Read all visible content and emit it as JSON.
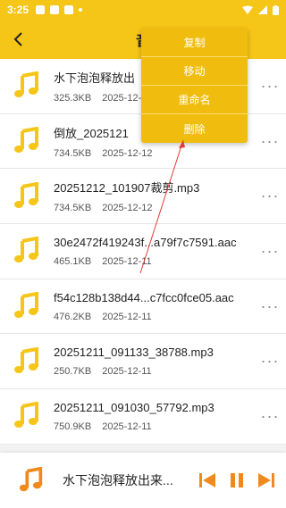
{
  "status": {
    "time": "3:25"
  },
  "header": {
    "title": "音"
  },
  "menu": {
    "items": [
      "复制",
      "移动",
      "重命名",
      "删除"
    ]
  },
  "files": [
    {
      "name": "水下泡泡释放出",
      "size": "325.3KB",
      "date": "2025-12-1"
    },
    {
      "name": "倒放_2025121",
      "size": "734.5KB",
      "date": "2025-12-12"
    },
    {
      "name": "20251212_101907裁剪.mp3",
      "size": "734.5KB",
      "date": "2025-12-12"
    },
    {
      "name": "30e2472f419243f...a79f7c7591.aac",
      "size": "465.1KB",
      "date": "2025-12-11"
    },
    {
      "name": "f54c128b138d44...c7fcc0fce05.aac",
      "size": "476.2KB",
      "date": "2025-12-11"
    },
    {
      "name": "20251211_091133_38788.mp3",
      "size": "250.7KB",
      "date": "2025-12-11"
    },
    {
      "name": "20251211_091030_57792.mp3",
      "size": "750.9KB",
      "date": "2025-12-11"
    }
  ],
  "player": {
    "title": "水下泡泡释放出来..."
  },
  "colors": {
    "accent": "#f5c518",
    "menu": "#f0bd0f",
    "player_icon": "#f08a1c"
  },
  "icons": {
    "back": "chevron-left-icon",
    "file": "music-note-icon",
    "more": "more-dots-icon",
    "prev": "skip-previous-icon",
    "pause": "pause-icon",
    "next": "skip-next-icon"
  }
}
